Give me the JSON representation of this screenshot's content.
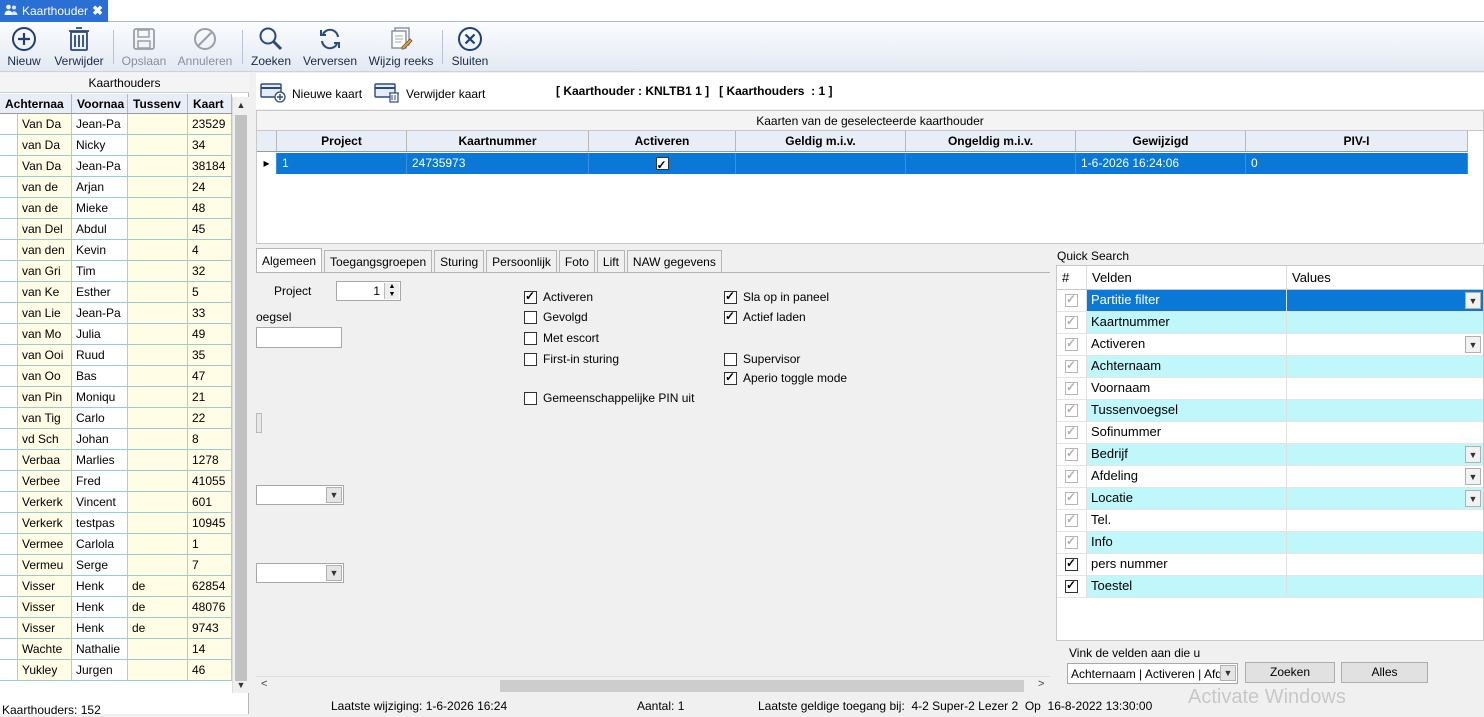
{
  "tab": {
    "label": "Kaarthouder",
    "close": "✖"
  },
  "toolbar": {
    "new": "Nieuw",
    "delete": "Verwijder",
    "save": "Opslaan",
    "cancel": "Annuleren",
    "search": "Zoeken",
    "refresh": "Verversen",
    "edit_series": "Wijzig reeks",
    "close": "Sluiten"
  },
  "left": {
    "caption": "Kaarthouders",
    "headers": [
      "Achternaa",
      "Voornaa",
      "Tussenv",
      "Kaart"
    ],
    "rows": [
      [
        "Van Da",
        "Jean-Pa",
        "",
        "23529"
      ],
      [
        "van Da",
        "Nicky",
        "",
        "34"
      ],
      [
        "Van Da",
        "Jean-Pa",
        "",
        "38184"
      ],
      [
        "van de",
        "Arjan",
        "",
        "24"
      ],
      [
        "van de",
        "Mieke",
        "",
        "48"
      ],
      [
        "van Del",
        "Abdul",
        "",
        "45"
      ],
      [
        "van den",
        "Kevin",
        "",
        "4"
      ],
      [
        "van Gri",
        "Tim",
        "",
        "32"
      ],
      [
        "van Ke",
        "Esther",
        "",
        "5"
      ],
      [
        "van Lie",
        "Jean-Pa",
        "",
        "33"
      ],
      [
        "van Mo",
        "Julia",
        "",
        "49"
      ],
      [
        "van Ooi",
        "Ruud",
        "",
        "35"
      ],
      [
        "van Oo",
        "Bas",
        "",
        "47"
      ],
      [
        "van Pin",
        "Moniqu",
        "",
        "21"
      ],
      [
        "van Tig",
        "Carlo",
        "",
        "22"
      ],
      [
        "vd Sch",
        "Johan",
        "",
        "8"
      ],
      [
        "Verbaa",
        "Marlies",
        "",
        "1278"
      ],
      [
        "Verbee",
        "Fred",
        "",
        "41055"
      ],
      [
        "Verkerk",
        "Vincent",
        "",
        "601"
      ],
      [
        "Verkerk",
        "testpas",
        "",
        "10945"
      ],
      [
        "Vermee",
        "Carlola",
        "",
        "1"
      ],
      [
        "Vermeu",
        "Serge",
        "",
        "7"
      ],
      [
        "Visser",
        "Henk",
        "de",
        "62854"
      ],
      [
        "Visser",
        "Henk",
        "de",
        "48076"
      ],
      [
        "Visser",
        "Henk",
        "de",
        "9743"
      ],
      [
        "Wachte",
        "Nathalie",
        "",
        "14"
      ],
      [
        "Yukley",
        "Jurgen",
        "",
        "46"
      ]
    ],
    "count": "Kaarthouders: 152"
  },
  "right": {
    "new_card": "Nieuwe kaart",
    "delete_card": "Verwijder kaart",
    "info": "[ Kaarthouder : KNLTB1 1 ]   [ Kaarthouders  : 1 ]",
    "cards_caption": "Kaarten van de geselecteerde kaarthouder",
    "cards_headers": [
      "Project",
      "Kaartnummer",
      "Activeren",
      "Geldig m.i.v.",
      "Ongeldig m.i.v.",
      "Gewijzigd",
      "PIV-I"
    ],
    "cards_row": {
      "project": "1",
      "kaartnummer": "24735973",
      "activeren": true,
      "geldig": "",
      "ongeldig": "",
      "gewijzigd": "1-6-2026 16:24:06",
      "piv": "0"
    }
  },
  "detail": {
    "tabs": [
      "Algemeen",
      "Toegangsgroepen",
      "Sturing",
      "Persoonlijk",
      "Foto",
      "Lift",
      "NAW gegevens"
    ],
    "project_label": "Project",
    "project_value": "1",
    "partial_label": "oegsel",
    "checkboxes_left": [
      {
        "label": "Activeren",
        "checked": true
      },
      {
        "label": "Gevolgd",
        "checked": false
      },
      {
        "label": "Met escort",
        "checked": false
      },
      {
        "label": "First-in sturing",
        "checked": false
      },
      {
        "label": "Gemeenschappelijke PIN uit",
        "checked": false
      }
    ],
    "checkboxes_right": [
      {
        "label": "Sla op in paneel",
        "checked": true
      },
      {
        "label": "Actief laden",
        "checked": true
      },
      {
        "label": "Supervisor",
        "checked": false
      },
      {
        "label": "Aperio toggle mode",
        "checked": true
      }
    ]
  },
  "quick_search": {
    "title": "Quick Search",
    "headers": [
      "#",
      "Velden",
      "Values"
    ],
    "rows": [
      {
        "field": "Partitie filter",
        "checked": true,
        "locked": true,
        "dropdown": true,
        "style": "sel"
      },
      {
        "field": "Kaartnummer",
        "checked": true,
        "locked": true,
        "dropdown": false,
        "style": "cyan"
      },
      {
        "field": "Activeren",
        "checked": true,
        "locked": true,
        "dropdown": true,
        "style": "white"
      },
      {
        "field": "Achternaam",
        "checked": true,
        "locked": true,
        "dropdown": false,
        "style": "cyan"
      },
      {
        "field": "Voornaam",
        "checked": true,
        "locked": true,
        "dropdown": false,
        "style": "white"
      },
      {
        "field": "Tussenvoegsel",
        "checked": true,
        "locked": true,
        "dropdown": false,
        "style": "cyan"
      },
      {
        "field": "Sofinummer",
        "checked": true,
        "locked": true,
        "dropdown": false,
        "style": "white"
      },
      {
        "field": "Bedrijf",
        "checked": true,
        "locked": true,
        "dropdown": true,
        "style": "cyan"
      },
      {
        "field": "Afdeling",
        "checked": true,
        "locked": true,
        "dropdown": true,
        "style": "white"
      },
      {
        "field": "Locatie",
        "checked": true,
        "locked": true,
        "dropdown": true,
        "style": "cyan"
      },
      {
        "field": "Tel.",
        "checked": true,
        "locked": true,
        "dropdown": false,
        "style": "white"
      },
      {
        "field": "Info",
        "checked": true,
        "locked": true,
        "dropdown": false,
        "style": "cyan"
      },
      {
        "field": "pers nummer",
        "checked": true,
        "locked": false,
        "dropdown": false,
        "style": "white"
      },
      {
        "field": "Toestel",
        "checked": true,
        "locked": false,
        "dropdown": false,
        "style": "cyan"
      }
    ],
    "hint": "Vink de velden aan die u",
    "combo_value": "Achternaam | Activeren | Afd",
    "search_button": "Zoeken",
    "all_button": "Alles"
  },
  "status": {
    "last_change": "Laatste wijziging: 1-6-2026 16:24",
    "count": "Aantal: 1",
    "last_access": "Laatste geldige toegang bij:  4-2 Super-2 Lezer 2  Op  16-8-2022 13:30:00"
  },
  "watermark": "Activate Windows"
}
